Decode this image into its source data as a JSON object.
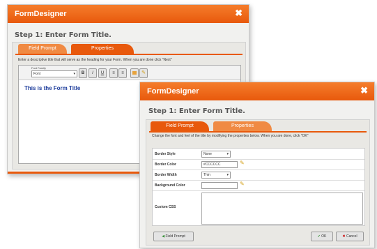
{
  "back_window": {
    "title": "FormDesigner",
    "close_glyph": "✖",
    "step_heading": "Step 1: Enter Form Title.",
    "tabs": [
      {
        "label": "Field Prompt",
        "active": true
      },
      {
        "label": "Properties",
        "active": false
      }
    ],
    "description": "Enter a descriptive title that will serve as the heading for your Form. When you are done click \"Next\"",
    "editor": {
      "font_label": "Font Family",
      "font_value": "Font",
      "toolbar_buttons": [
        "B",
        "I",
        "U",
        "≡",
        "≡"
      ],
      "content": "This is the Form Title"
    }
  },
  "front_window": {
    "title": "FormDesigner",
    "close_glyph": "✖",
    "step_heading": "Step 1: Enter Form Title.",
    "tabs": [
      {
        "label": "Field Prompt",
        "active": false
      },
      {
        "label": "Properties",
        "active": true
      }
    ],
    "description": "Change the font and feel of the title by modifying the properties below. When you are done, click \"OK\"",
    "properties": [
      {
        "label": "Border Style",
        "value": "None"
      },
      {
        "label": "Border Color",
        "value": "#CCCCCC"
      },
      {
        "label": "Border Width",
        "value": "Thin"
      },
      {
        "label": "Background Color",
        "value": ""
      },
      {
        "label": "Custom CSS",
        "value": ""
      }
    ],
    "buttons": {
      "field_prompt": "Field Prompt",
      "ok": "OK",
      "cancel": "Cancel"
    }
  }
}
